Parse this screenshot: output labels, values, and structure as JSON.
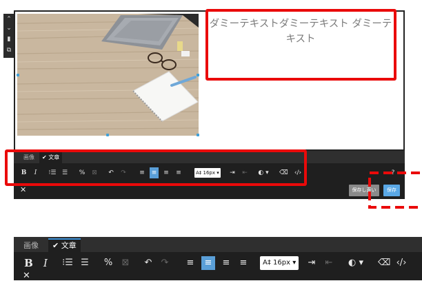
{
  "editor": {
    "dummy_text": "ダミーテキストダミーテキスト ダミーテキスト",
    "tabs": [
      "画像",
      "✔ 文章"
    ],
    "toolbar": {
      "bold": "B",
      "italic": "I",
      "ordered_list": "⁝☰",
      "unordered_list": "☰",
      "link": "%",
      "unlink": "⊠",
      "undo": "↶",
      "redo": "↷",
      "align_left": "≡",
      "align_center": "≡",
      "align_right": "≡",
      "align_justify": "≡",
      "font_size": "A‡ 16px ▾",
      "indent": "⇥",
      "outdent": "⇤",
      "color": "◐ ▾",
      "eraser": "⌫",
      "source": "‹/›",
      "help": "?"
    },
    "close": "✕",
    "save_as": "保存し直い",
    "save": "保存"
  },
  "lower_toolbar": {
    "tabs": [
      "画像",
      "✔ 文章"
    ],
    "bold": "B",
    "italic": "I",
    "font_size": "A‡ 16px ▾",
    "close": "✕"
  },
  "colors": {
    "annotation": "#ea0a0a",
    "toolbar_bg": "#1f1f1f",
    "accent": "#5a9fd8",
    "save_button": "#5aa8e6",
    "save_as_button": "#8a8a8a"
  }
}
